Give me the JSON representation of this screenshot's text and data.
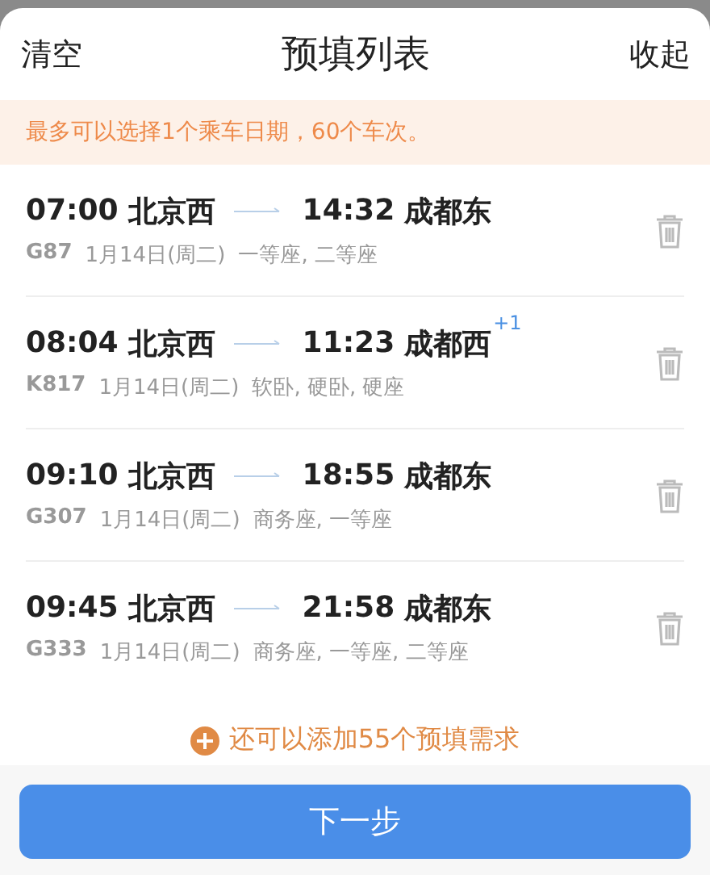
{
  "header": {
    "left_action": "清空",
    "title": "预填列表",
    "right_action": "收起"
  },
  "notice": "最多可以选择1个乘车日期，60个车次。",
  "trips": [
    {
      "depart_time": "07:00",
      "from": "北京西",
      "arrive_time": "14:32",
      "to": "成都东",
      "train": "G87",
      "date": "1月14日(周二)",
      "seats": "一等座, 二等座"
    },
    {
      "depart_time": "08:04",
      "from": "北京西",
      "arrive_time": "11:23",
      "to": "成都西",
      "day_offset": "+1",
      "train": "K817",
      "date": "1月14日(周二)",
      "seats": "软卧, 硬卧, 硬座"
    },
    {
      "depart_time": "09:10",
      "from": "北京西",
      "arrive_time": "18:55",
      "to": "成都东",
      "train": "G307",
      "date": "1月14日(周二)",
      "seats": "商务座, 一等座"
    },
    {
      "depart_time": "09:45",
      "from": "北京西",
      "arrive_time": "21:58",
      "to": "成都东",
      "train": "G333",
      "date": "1月14日(周二)",
      "seats": "商务座, 一等座, 二等座"
    }
  ],
  "add_link": "还可以添加55个预填需求",
  "next_button": "下一步"
}
